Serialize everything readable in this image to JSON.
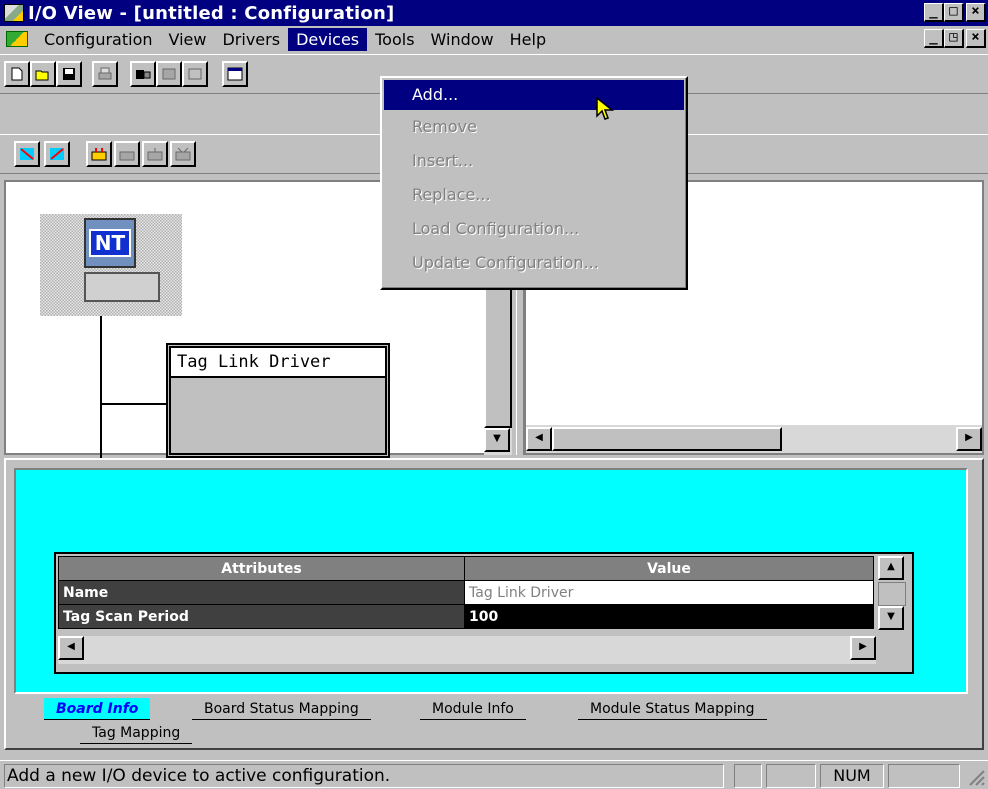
{
  "window": {
    "title": "I/O View - [untitled : Configuration]"
  },
  "menubar": {
    "items": [
      {
        "label": "Configuration",
        "u": "C"
      },
      {
        "label": "View",
        "u": "V"
      },
      {
        "label": "Drivers",
        "u": "D"
      },
      {
        "label": "Devices",
        "u": "e"
      },
      {
        "label": "Tools",
        "u": "T"
      },
      {
        "label": "Window",
        "u": "W"
      },
      {
        "label": "Help",
        "u": "H"
      }
    ]
  },
  "devices_menu": {
    "items": [
      {
        "label": "Add...",
        "enabled": true
      },
      {
        "label": "Remove",
        "enabled": false
      },
      {
        "label": "Insert...",
        "enabled": false
      },
      {
        "label": "Replace...",
        "enabled": false
      },
      {
        "label": "Load Configuration...",
        "enabled": false
      },
      {
        "label": "Update Configuration...",
        "enabled": false
      }
    ]
  },
  "tree": {
    "computer_label": "NT",
    "driver_node_label": "Tag Link Driver"
  },
  "properties": {
    "columns": [
      "Attributes",
      "Value"
    ],
    "rows": [
      {
        "attribute": "Name",
        "value": "Tag Link Driver"
      },
      {
        "attribute": "Tag Scan Period",
        "value": "100"
      }
    ]
  },
  "tabs": {
    "row1": [
      "Board Info",
      "Board Status Mapping",
      "Module Info",
      "Module Status Mapping"
    ],
    "row2": [
      "Tag Mapping"
    ],
    "active": "Board Info"
  },
  "statusbar": {
    "message": "Add a new I/O device to active configuration.",
    "num": "NUM"
  },
  "colors": {
    "title_bar": "#000080",
    "panel_bg": "#00ffff",
    "face": "#c0c0c0"
  }
}
